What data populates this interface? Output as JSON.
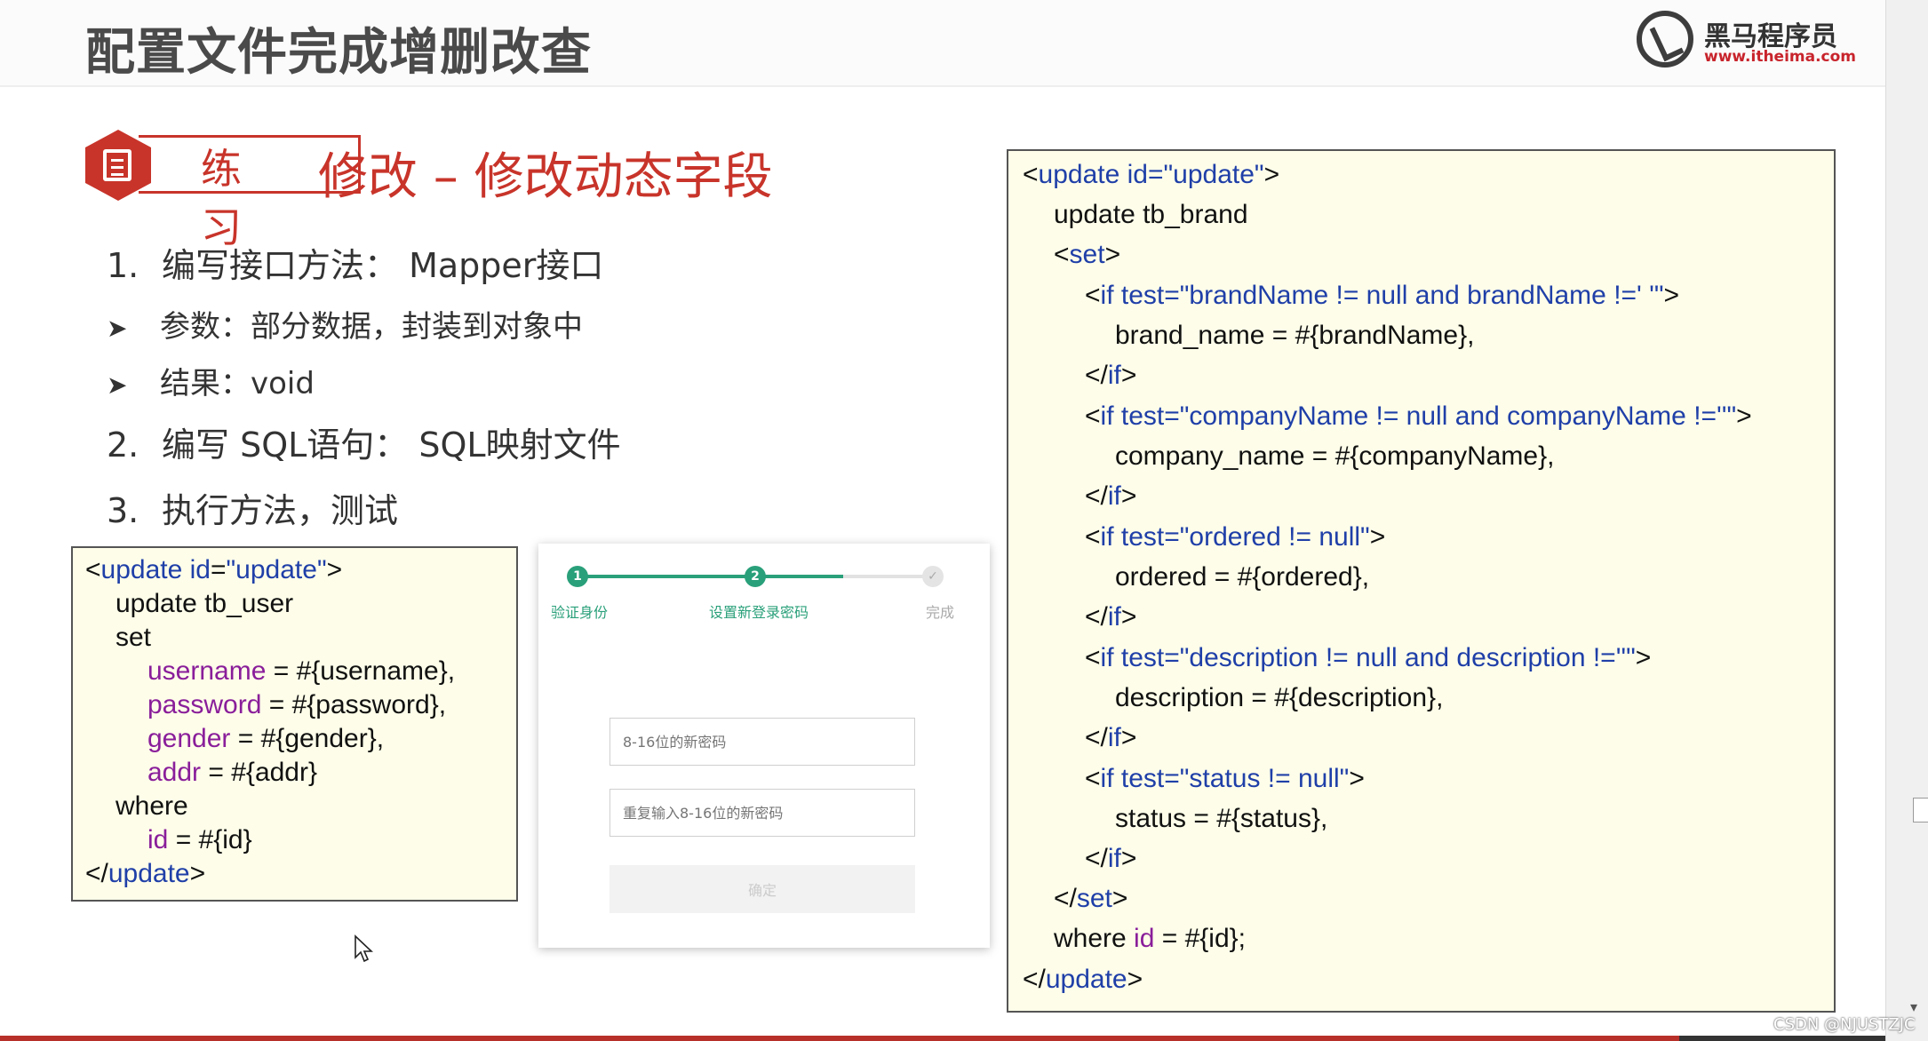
{
  "slide": {
    "title": "配置文件完成增删改查",
    "logo_cn": "黑马程序员",
    "logo_url": "www.itheima.com",
    "badge": "练习",
    "heading": "修改 – 修改动态字段",
    "steps": [
      {
        "num": "1.",
        "text": "编写接口方法： Mapper接口"
      },
      {
        "num": "2.",
        "text": "编写 SQL语句： SQL映射文件"
      },
      {
        "num": "3.",
        "text": "执行方法，测试"
      }
    ],
    "bullets": [
      {
        "arrow": "➤",
        "text": "参数：部分数据，封装到对象中"
      },
      {
        "arrow": "➤",
        "text": "结果：void"
      }
    ]
  },
  "left_code": {
    "l1a": "<",
    "l1b": "update",
    "l1c": " ",
    "l1d": "id",
    "l1e": "=",
    "l1f": "\"update\"",
    "l1g": ">",
    "l2": "update tb_user",
    "l3": "set",
    "l4a": "username",
    "l4b": " = #{username},",
    "l5a": "password",
    "l5b": " = #{password},",
    "l6a": "gender",
    "l6b": " = #{gender},",
    "l7a": "addr",
    "l7b": " = #{addr}",
    "l8": "where",
    "l9a": "id",
    "l9b": " = #{id}",
    "l10a": "</",
    "l10b": "update",
    "l10c": ">"
  },
  "right_code": {
    "r1a": "<",
    "r1b": "update id=",
    "r1c": "\"update\"",
    "r1d": ">",
    "r2": "update tb_brand",
    "r3a": "<",
    "r3b": "set",
    "r3c": ">",
    "r4a": "<",
    "r4b": "if test=",
    "r4c": "\"brandName != null and brandName !=' '\"",
    "r4d": ">",
    "r5": "brand_name = #{brandName},",
    "r6a": "</",
    "r6b": "if",
    "r6c": ">",
    "r7a": "<",
    "r7b": "if test=",
    "r7c": "\"companyName != null and companyName !=''\"",
    "r7d": ">",
    "r8": "company_name = #{companyName},",
    "r9a": "</",
    "r9b": "if",
    "r9c": ">",
    "r10a": "<",
    "r10b": "if test=",
    "r10c": "\"ordered != null\"",
    "r10d": ">",
    "r11": "ordered = #{ordered},",
    "r12a": "</",
    "r12b": "if",
    "r12c": ">",
    "r13a": "<",
    "r13b": "if test=",
    "r13c": "\"description != null and description !=''\"",
    "r13d": ">",
    "r14": "description = #{description},",
    "r15a": "</",
    "r15b": "if",
    "r15c": ">",
    "r16a": "<",
    "r16b": "if test=",
    "r16c": "\"status != null\"",
    "r16d": ">",
    "r17": "status = #{status},",
    "r18a": "</",
    "r18b": "if",
    "r18c": ">",
    "r19a": "</",
    "r19b": "set",
    "r19c": ">",
    "r20a": "where ",
    "r20b": "id",
    "r20c": " = #{id};",
    "r21a": "</",
    "r21b": "update",
    "r21c": ">"
  },
  "dialog": {
    "step1_num": "1",
    "step1_label": "验证身份",
    "step2_num": "2",
    "step2_label": "设置新登录密码",
    "step3_mark": "✓",
    "step3_label": "完成",
    "input1_placeholder": "8-16位的新密码",
    "input2_placeholder": "重复输入8-16位的新密码",
    "confirm_label": "确定"
  },
  "watermark": "CSDN @NJUSTZJC",
  "colors": {
    "accent_red": "#c8342a",
    "code_blue": "#1f3fa8",
    "code_purple": "#8a1e9a",
    "step_green": "#2aa07a",
    "code_bg": "#fdfde9"
  }
}
